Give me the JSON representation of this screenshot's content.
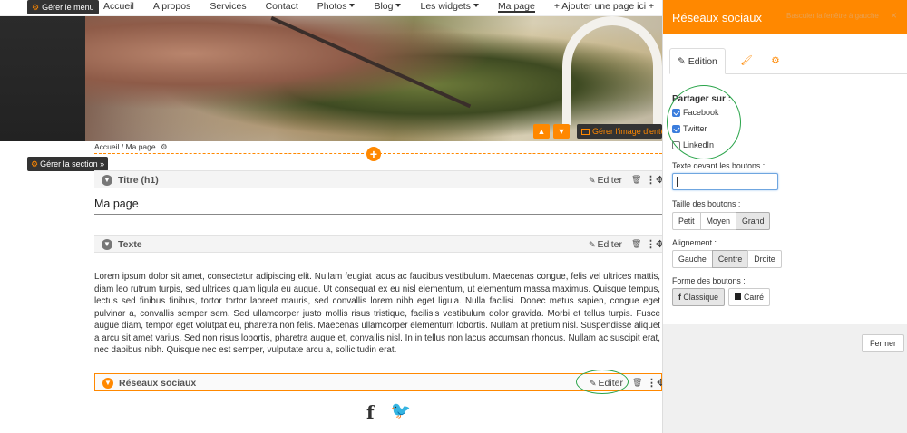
{
  "nav": {
    "manage_menu": "Gérer le menu",
    "items": [
      {
        "label": "Accueil",
        "caret": false,
        "active": false
      },
      {
        "label": "A propos",
        "caret": false,
        "active": false
      },
      {
        "label": "Services",
        "caret": false,
        "active": false
      },
      {
        "label": "Contact",
        "caret": false,
        "active": false
      },
      {
        "label": "Photos",
        "caret": true,
        "active": false
      },
      {
        "label": "Blog",
        "caret": true,
        "active": false
      },
      {
        "label": "Les widgets",
        "caret": true,
        "active": false
      },
      {
        "label": "Ma page",
        "caret": false,
        "active": true
      },
      {
        "label": "+ Ajouter une page ici +",
        "caret": false,
        "active": false
      }
    ]
  },
  "banner": {
    "manage_header": "Gérer l'image d'entête",
    "up_icon": "arrow-up-icon",
    "down_icon": "arrow-down-icon"
  },
  "breadcrumb": {
    "home": "Accueil",
    "separator": "/",
    "current": "Ma page"
  },
  "manage_section": "Gérer la section",
  "blocks": {
    "title": {
      "label": "Titre (h1)",
      "edit": "Editer",
      "content": "Ma page"
    },
    "text": {
      "label": "Texte",
      "edit": "Editer",
      "content": "Lorem ipsum dolor sit amet, consectetur adipiscing elit. Nullam feugiat lacus ac faucibus vestibulum. Maecenas congue, felis vel ultrices mattis, diam leo rutrum turpis, sed ultrices quam ligula eu augue. Ut consequat ex eu nisl elementum, ut elementum massa maximus. Quisque tempus, lectus sed finibus finibus, tortor tortor laoreet mauris, sed convallis lorem nibh eget ligula. Nulla facilisi. Donec metus sapien, congue eget pulvinar a, convallis semper sem. Sed ullamcorper justo mollis risus tristique, facilisis vestibulum dolor gravida. Morbi et tellus turpis. Fusce augue diam, tempor eget volutpat eu, pharetra non felis. Maecenas ullamcorper elementum lobortis. Nullam at pretium nisl. Suspendisse aliquet a arcu sit amet varius. Sed non risus lobortis, pharetra augue et, convallis nisl. In in tellus non lacus accumsan rhoncus. Nullam ac suscipit erat, nec dapibus nibh. Quisque nec est semper, vulputate arcu a, sollicitudin erat."
    },
    "social": {
      "label": "Réseaux sociaux",
      "edit": "Editer",
      "icons": [
        "facebook-icon",
        "twitter-icon"
      ]
    }
  },
  "panel": {
    "title": "Réseaux sociaux",
    "left_link": "Basculer la fenêtre à gauche",
    "close_glyph": "×",
    "tabs": {
      "edition": "Edition",
      "brush_icon": "brush-icon",
      "gear_icon": "gear-icon"
    },
    "share_label": "Partager sur :",
    "networks": [
      {
        "label": "Facebook",
        "checked": true
      },
      {
        "label": "Twitter",
        "checked": true
      },
      {
        "label": "LinkedIn",
        "checked": false
      }
    ],
    "text_before_label": "Texte devant les boutons :",
    "text_before_value": "",
    "size_label": "Taille des boutons :",
    "sizes": [
      {
        "label": "Petit",
        "selected": false
      },
      {
        "label": "Moyen",
        "selected": false
      },
      {
        "label": "Grand",
        "selected": true
      }
    ],
    "align_label": "Alignement :",
    "aligns": [
      {
        "label": "Gauche",
        "selected": false
      },
      {
        "label": "Centre",
        "selected": true
      },
      {
        "label": "Droite",
        "selected": false
      }
    ],
    "shape_label": "Forme des boutons :",
    "shapes": [
      {
        "label": "Classique",
        "selected": true
      },
      {
        "label": "Carré",
        "selected": false
      }
    ],
    "close_button": "Fermer"
  },
  "colors": {
    "accent": "#ff8800",
    "highlight_circle": "#2aa44a",
    "dark_button": "#333333"
  }
}
